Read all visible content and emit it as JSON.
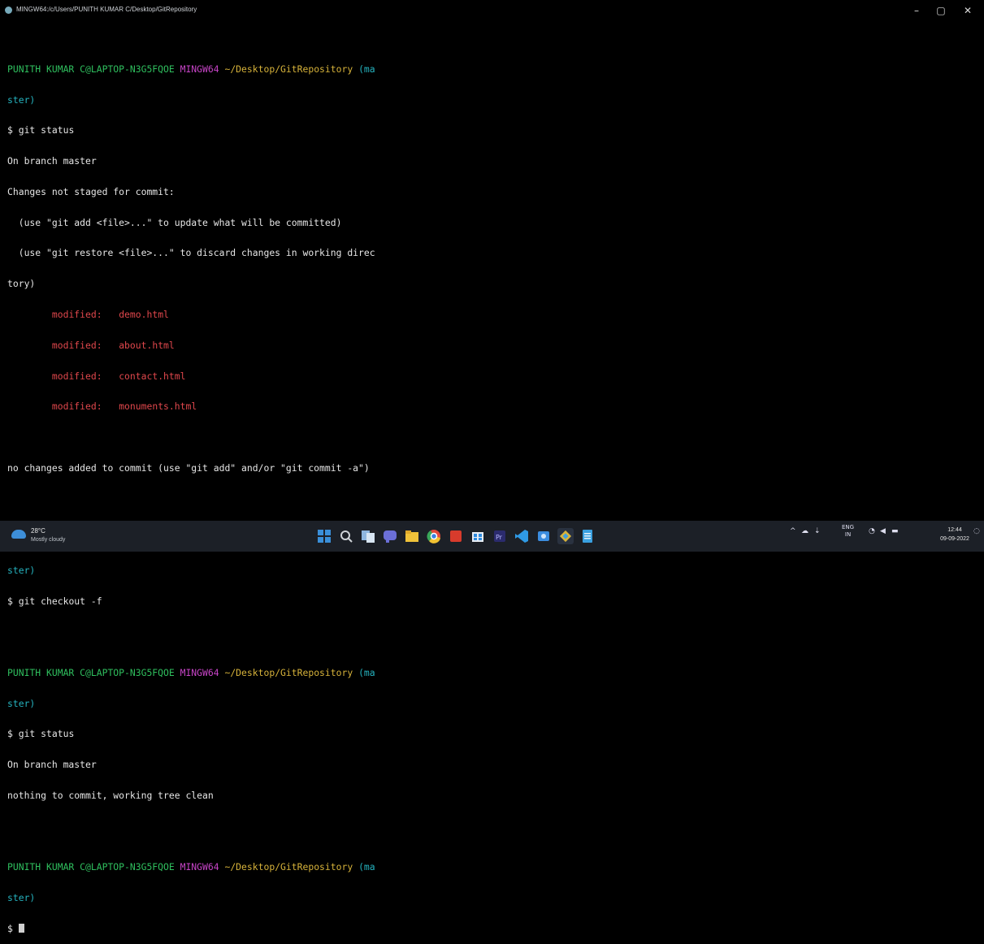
{
  "window": {
    "title": "MINGW64:/c/Users/PUNITH KUMAR C/Desktop/GitRepository",
    "controls": {
      "minimize": "–",
      "maximize": "▢",
      "close": "✕"
    }
  },
  "prompt": {
    "user_host": "PUNITH KUMAR C@LAPTOP-N3G5FQOE",
    "shell": "MINGW64",
    "path": "~/Desktop/GitRepository",
    "branch_open": "(ma",
    "branch_close": "ster)",
    "branch_open_alt": "(master",
    "branch_close_alt": ")",
    "symbol": "$"
  },
  "session": {
    "cmd1": "git status",
    "out1": [
      "On branch master",
      "Changes not staged for commit:",
      "  (use \"git add <file>...\" to update what will be committed)",
      "  (use \"git restore <file>...\" to discard changes in working direc",
      "tory)"
    ],
    "modified_label": "modified:",
    "modified_files": [
      "demo.html",
      "about.html",
      "contact.html",
      "monuments.html"
    ],
    "out1_tail": "no changes added to commit (use \"git add\" and/or \"git commit -a\")",
    "cmd2": "git checkout -f",
    "cmd3": "git status",
    "out3": [
      "On branch master",
      "nothing to commit, working tree clean"
    ]
  },
  "taskbar": {
    "weather": {
      "temp": "28°C",
      "condition": "Mostly cloudy",
      "icon": "cloud-sun-icon"
    },
    "apps": [
      {
        "name": "start-icon",
        "color": "#3a8fd9"
      },
      {
        "name": "search-icon",
        "color": "#cfd3d8"
      },
      {
        "name": "task-view-icon",
        "color": "#8fb7e0"
      },
      {
        "name": "chat-icon",
        "color": "#6b6fd8"
      },
      {
        "name": "file-explorer-icon",
        "color": "#f0c23a"
      },
      {
        "name": "chrome-icon",
        "color": "#e24a3b"
      },
      {
        "name": "office-icon",
        "color": "#d83b2c"
      },
      {
        "name": "store-icon",
        "color": "#2f8bdf"
      },
      {
        "name": "premiere-icon",
        "color": "#2b2b6e"
      },
      {
        "name": "vscode-icon",
        "color": "#2f9ae6"
      },
      {
        "name": "photos-icon",
        "color": "#3b8de0"
      },
      {
        "name": "git-bash-icon",
        "color": "#d9b43a"
      },
      {
        "name": "notepad-icon",
        "color": "#3aa0e0"
      }
    ],
    "tray": {
      "lang_top": "ENG",
      "lang_bottom": "IN",
      "time": "12:44",
      "date": "09-09-2022"
    }
  }
}
